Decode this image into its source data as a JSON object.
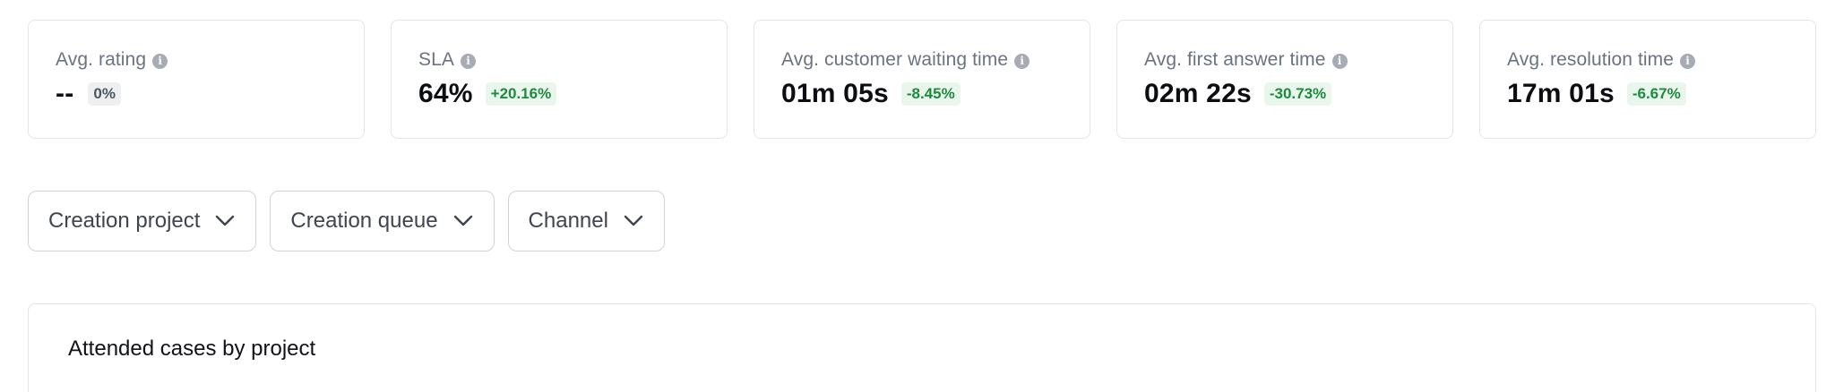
{
  "kpis": [
    {
      "label": "Avg. rating",
      "value": "--",
      "change": "0%",
      "change_status": "neutral"
    },
    {
      "label": "SLA",
      "value": "64%",
      "change": "+20.16%",
      "change_status": "positive"
    },
    {
      "label": "Avg. customer waiting time",
      "value": "01m 05s",
      "change": "-8.45%",
      "change_status": "positive"
    },
    {
      "label": "Avg. first answer time",
      "value": "02m 22s",
      "change": "-30.73%",
      "change_status": "positive"
    },
    {
      "label": "Avg. resolution time",
      "value": "17m 01s",
      "change": "-6.67%",
      "change_status": "positive"
    }
  ],
  "icons": {
    "info": "info-icon",
    "dropdown": "chevron-down-icon"
  },
  "filters": [
    {
      "label": "Creation project"
    },
    {
      "label": "Creation queue"
    },
    {
      "label": "Channel"
    }
  ],
  "chart_section": {
    "title": "Attended cases by project"
  },
  "colors": {
    "positive_text": "#1f8a3d",
    "positive_bg": "#e8f6ec",
    "neutral_text": "#4b5563",
    "neutral_bg": "#eeeff1",
    "border": "#e3e5e8"
  }
}
